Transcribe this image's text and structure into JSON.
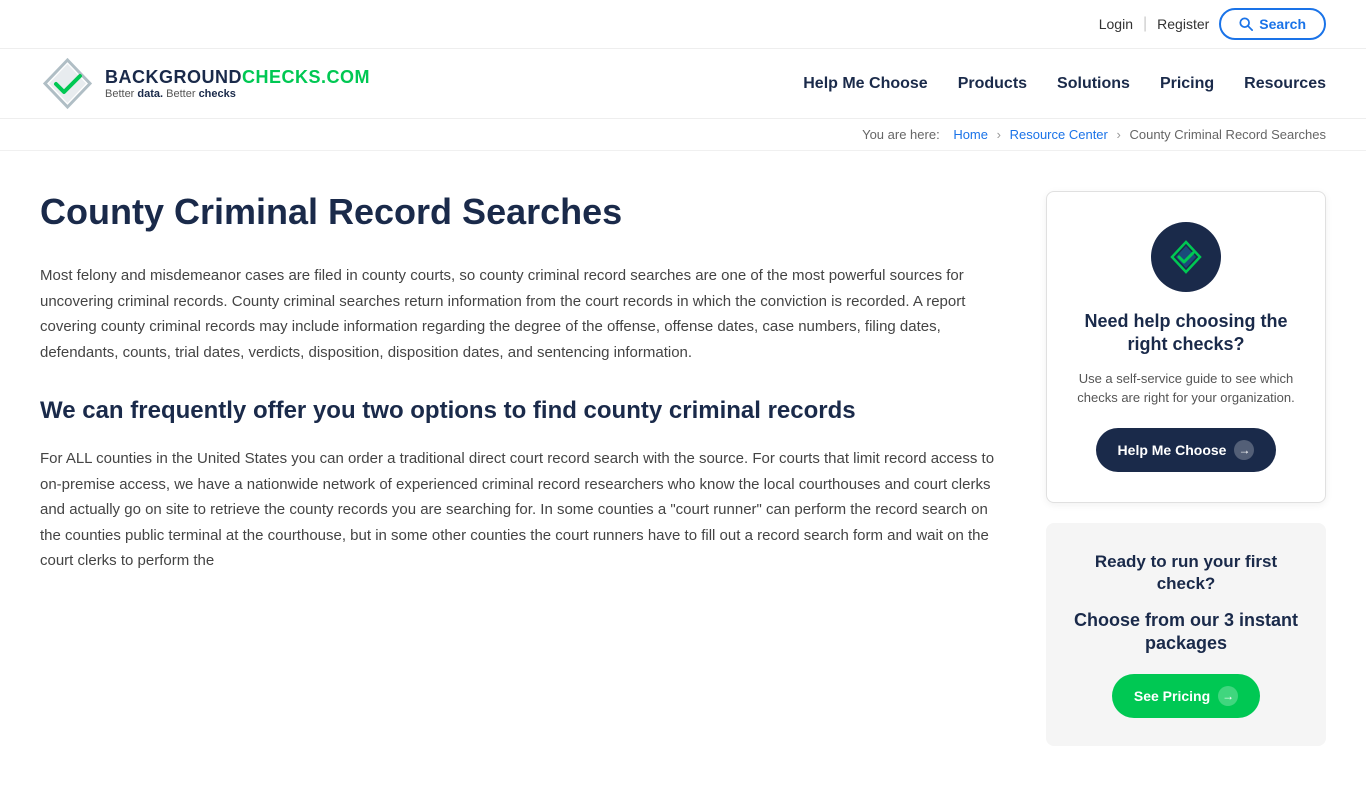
{
  "topbar": {
    "login_label": "Login",
    "register_label": "Register",
    "search_label": "Search"
  },
  "nav": {
    "logo_name_part1": "BACKGROUND",
    "logo_name_part2": "CHECKS.COM",
    "logo_tagline_part1": "Better",
    "logo_tagline_word1": "data.",
    "logo_tagline_part2": "Better",
    "logo_tagline_word2": "checks",
    "links": [
      {
        "label": "Help Me Choose",
        "href": "#"
      },
      {
        "label": "Products",
        "href": "#"
      },
      {
        "label": "Solutions",
        "href": "#"
      },
      {
        "label": "Pricing",
        "href": "#"
      },
      {
        "label": "Resources",
        "href": "#"
      }
    ]
  },
  "breadcrumb": {
    "you_are_here": "You are here:",
    "home": "Home",
    "resource_center": "Resource Center",
    "current": "County Criminal Record Searches"
  },
  "main": {
    "page_title": "County Criminal Record Searches",
    "intro_text": "Most felony and misdemeanor cases are filed in county courts, so county criminal record searches are one of the most powerful sources for uncovering criminal records. County criminal searches return information from the court records in which the conviction is recorded. A report covering county criminal records may include information regarding the degree of the offense, offense dates, case numbers, filing dates, defendants, counts, trial dates, verdicts, disposition, disposition dates, and sentencing information.",
    "section_heading": "We can frequently offer you two options to find county criminal records",
    "body_text": "For ALL counties in the United States you can order a traditional direct court record search with the source. For courts that limit record access to on-premise access, we have a nationwide network of experienced criminal record researchers who know the local courthouses and court clerks and actually go on site to retrieve the county records you are searching for. In some counties a \"court runner\" can perform the record search on the counties public terminal at the courthouse, but in some other counties the court runners have to fill out a record search form and wait on the court clerks to perform the"
  },
  "sidebar": {
    "help_card": {
      "title": "Need help choosing the right checks?",
      "description": "Use a self-service guide to see which checks are right for your organization.",
      "button_label": "Help Me Choose"
    },
    "pricing_card": {
      "title": "Ready to run your first check?",
      "subtitle": "Choose from our 3 instant packages",
      "button_label": "See Pricing"
    }
  }
}
